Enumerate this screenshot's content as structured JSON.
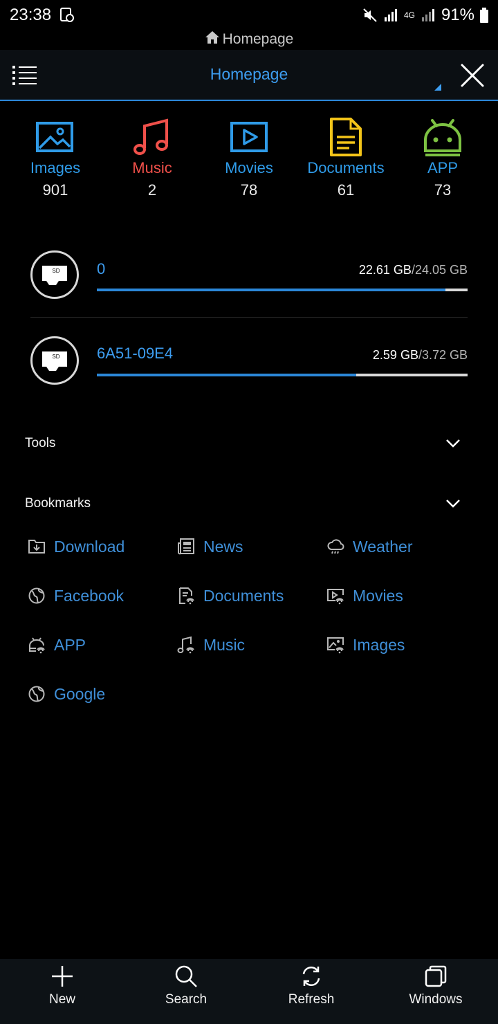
{
  "status_bar": {
    "time": "23:38",
    "network": "4G",
    "battery": "91%",
    "icons": [
      "location-icon",
      "mute-icon",
      "signal-icon",
      "signal-icon-2",
      "battery-icon"
    ]
  },
  "title_strip": {
    "label": "Homepage",
    "icon": "home-icon"
  },
  "address_bar": {
    "title": "Homepage",
    "menu_icon": "menu-icon",
    "close_icon": "close-icon"
  },
  "categories": [
    {
      "label": "Images",
      "count": "901",
      "color": "#2f9be8",
      "icon": "image-icon"
    },
    {
      "label": "Music",
      "count": "2",
      "color": "#f0504a",
      "icon": "music-note-icon"
    },
    {
      "label": "Movies",
      "count": "78",
      "color": "#2f9be8",
      "icon": "play-icon"
    },
    {
      "label": "Documents",
      "count": "61",
      "color": "#f3c419",
      "icon": "document-icon"
    },
    {
      "label": "APP",
      "count": "73",
      "color": "#7dc242",
      "icon": "android-icon"
    }
  ],
  "storage": [
    {
      "name": "0",
      "used": "22.61 GB",
      "total": "/24.05 GB",
      "fraction": 0.94
    },
    {
      "name": "6A51-09E4",
      "used": "2.59 GB",
      "total": "/3.72 GB",
      "fraction": 0.7
    }
  ],
  "sections": {
    "tools": "Tools",
    "bookmarks": "Bookmarks"
  },
  "bookmarks": [
    {
      "label": "Download",
      "icon": "download-folder-icon"
    },
    {
      "label": "News",
      "icon": "news-icon"
    },
    {
      "label": "Weather",
      "icon": "weather-icon"
    },
    {
      "label": "Facebook",
      "icon": "globe-icon"
    },
    {
      "label": "Documents",
      "icon": "web-document-icon"
    },
    {
      "label": "Movies",
      "icon": "web-movie-icon"
    },
    {
      "label": "APP",
      "icon": "web-app-icon"
    },
    {
      "label": "Music",
      "icon": "web-music-icon"
    },
    {
      "label": "Images",
      "icon": "web-image-icon"
    },
    {
      "label": "Google",
      "icon": "globe-icon"
    }
  ],
  "bottom_bar": {
    "new": "New",
    "search": "Search",
    "refresh": "Refresh",
    "windows": "Windows"
  },
  "colors": {
    "accent": "#2b87d8",
    "link": "#3f8fd8",
    "background": "#000000"
  }
}
